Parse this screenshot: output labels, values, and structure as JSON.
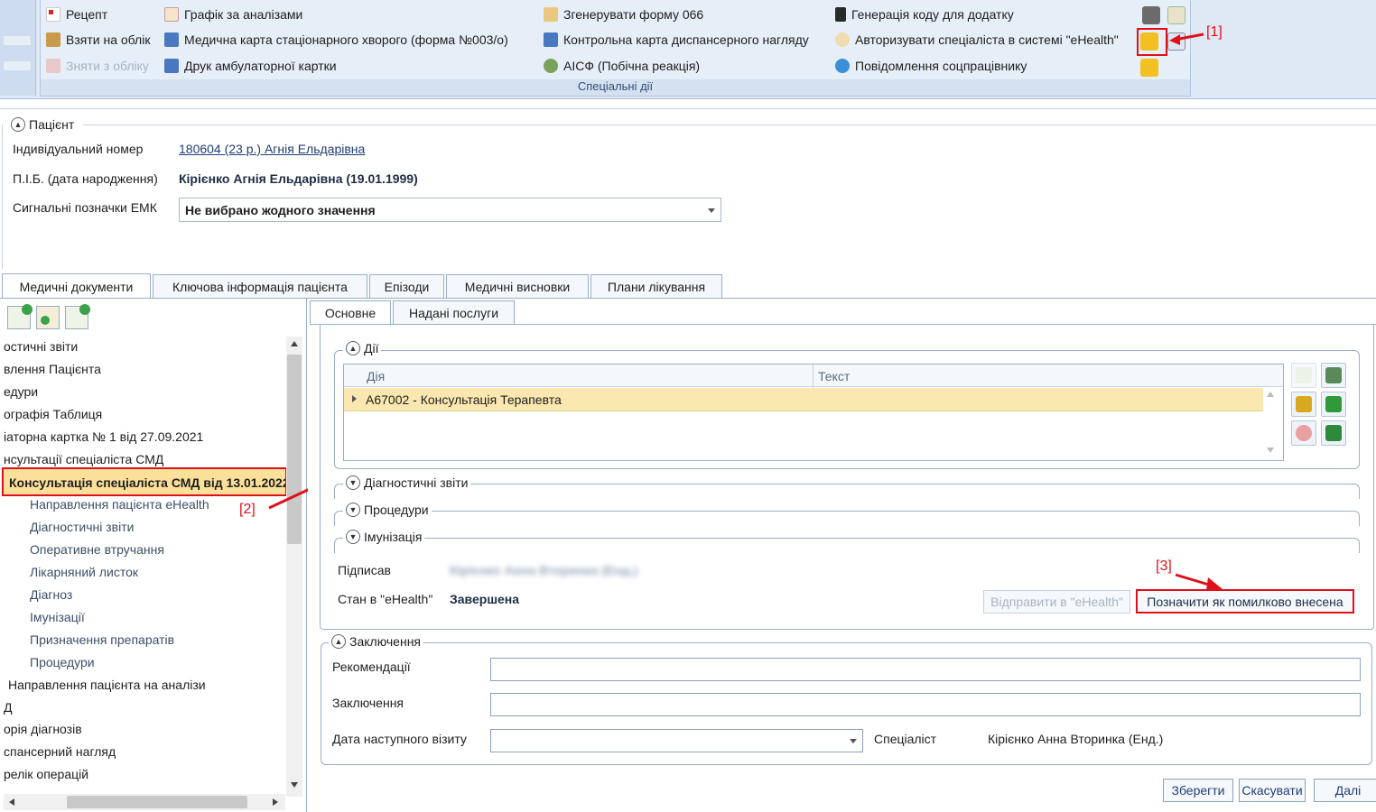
{
  "ribbon": {
    "group_label": "Спеціальні дії",
    "items": [
      {
        "label": "Рецепт",
        "icon": "prescription-icon",
        "disabled": false
      },
      {
        "label": "Взяти на облік",
        "icon": "register-icon",
        "disabled": false
      },
      {
        "label": "Зняти з обліку",
        "icon": "unregister-icon",
        "disabled": true
      },
      {
        "label": "Графік за аналізами",
        "icon": "chart-icon",
        "disabled": false
      },
      {
        "label": "Медична карта стаціонарного хворого (форма №003/о)",
        "icon": "medical-card-icon",
        "disabled": false
      },
      {
        "label": "Друк амбулаторної картки",
        "icon": "print-card-icon",
        "disabled": false
      },
      {
        "label": "Згенерувати форму 066",
        "icon": "form-066-icon",
        "disabled": false
      },
      {
        "label": "Контрольна карта диспансерного нагляду",
        "icon": "control-card-icon",
        "disabled": false
      },
      {
        "label": "АІСФ (Побічна реакція)",
        "icon": "aisf-icon",
        "disabled": false
      },
      {
        "label": "Генерація коду для додатку",
        "icon": "phone-icon",
        "disabled": false
      },
      {
        "label": "Авторизувати спеціаліста в системі \"eHealth\"",
        "icon": "authorize-icon",
        "disabled": false
      },
      {
        "label": "Повідомлення соцпрацівнику",
        "icon": "message-icon",
        "disabled": false
      }
    ]
  },
  "annotations": {
    "a1": "[1]",
    "a2": "[2]",
    "a3": "[3]"
  },
  "patient": {
    "section_title": "Пацієнт",
    "id_label": "Індивідуальний номер",
    "id_value": "180604 (23 р.) Агнія Ельдарівна",
    "name_label": "П.І.Б. (дата народження)",
    "name_value": "Кірієнко Агнія Ельдарівна (19.01.1999)",
    "signals_label": "Сигнальні позначки ЕМК",
    "signals_value": "Не вибрано жодного значення"
  },
  "main_tabs": [
    "Медичні документи",
    "Ключова інформація пацієнта",
    "Епізоди",
    "Медичні висновки",
    "Плани лікування"
  ],
  "sub_tabs": [
    "Основне",
    "Надані послуги"
  ],
  "tree": {
    "items_top": [
      "остичні звіти",
      "влення Пацієнта",
      "едури",
      "ографія Таблиця",
      "іаторна картка № 1 від 27.09.2021",
      "нсультації спеціаліста СМД"
    ],
    "selected": "Консультація спеціаліста СМД від 13.01.2022",
    "children": [
      "Направлення пацієнта eHealth",
      "Діагностичні звіти",
      "Оперативне втручання",
      "Лікарняний листок",
      "Діагноз",
      "Імунізації",
      "Призначення препаратів",
      "Процедури"
    ],
    "items_bottom": [
      "Направлення пацієнта на аналізи",
      "Д",
      "орія діагнозів",
      "спансерний нагляд",
      "релік операцій"
    ]
  },
  "actions": {
    "section_title": "Дії",
    "col_action": "Дія",
    "col_text": "Текст",
    "rows": [
      {
        "action": "A67002 - Консультація Терапевта",
        "text": ""
      }
    ]
  },
  "sections": {
    "diag": "Діагностичні звіти",
    "proc": "Процедури",
    "immun": "Імунізація"
  },
  "sign": {
    "signed_label": "Підписав",
    "signed_value": "Кірієнко Анна Вторинка (Енд.)",
    "status_label": "Стан в \"eHealth\"",
    "status_value": "Завершена",
    "send_btn": "Відправити в \"eHealth\"",
    "mark_btn": "Позначити як помилково внесена"
  },
  "conclusion": {
    "section_title": "Заключення",
    "rec_label": "Рекомендації",
    "concl_label": "Заключення",
    "next_visit_label": "Дата наступного візиту",
    "specialist_label": "Спеціаліст",
    "specialist_value": "Кірієнко Анна Вторинка (Енд.)"
  },
  "footer": {
    "save": "Зберегти",
    "cancel": "Скасувати",
    "next": "Далі"
  }
}
